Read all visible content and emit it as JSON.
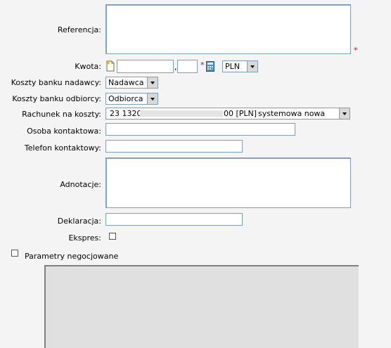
{
  "form": {
    "referencja_label": "Referencja:",
    "kwota_label": "Kwota:",
    "kwota_sep": ",",
    "currency_selected": "PLN",
    "koszty_nadawcy_label": "Koszty banku nadawcy:",
    "koszty_nadawcy_value": "Nadawca",
    "koszty_odbiorcy_label": "Koszty banku odbiorcy:",
    "koszty_odbiorcy_value": "Odbiorca",
    "rachunek_label": "Rachunek na koszty:",
    "rachunek_prefix": "23 1320",
    "rachunek_suffix": "00 [PLN]",
    "rachunek_name": "systemowa nowa",
    "osoba_label": "Osoba kontaktowa:",
    "telefon_label": "Telefon kontaktowy:",
    "adnotacje_label": "Adnotacje:",
    "deklaracja_label": "Deklaracja:",
    "ekspres_label": "Ekspres:",
    "parametry_label": "Parametry negocjowane",
    "required_mark": "*"
  },
  "colors": {
    "required": "#e00000",
    "background": "#f4f4f4",
    "panel": "#e0e0e0"
  },
  "icons": [
    "new-document-icon",
    "calculator-icon"
  ]
}
